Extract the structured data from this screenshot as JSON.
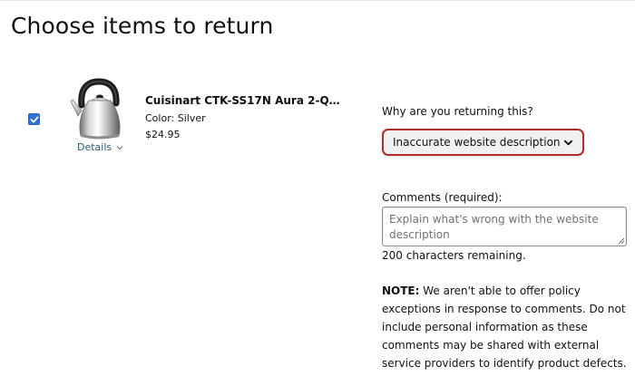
{
  "page": {
    "title": "Choose items to return"
  },
  "item": {
    "selected": true,
    "image_icon": "kettle-image",
    "details_label": "Details",
    "title": "Cuisinart CTK-SS17N Aura 2-Quart...",
    "color": "Color: Silver",
    "price": "$24.95"
  },
  "reason": {
    "label": "Why are you returning this?",
    "selected": "Inaccurate website description",
    "error_color": "#b12c2c"
  },
  "comments": {
    "label": "Comments (required):",
    "value": "",
    "placeholder": "Explain what's wrong with the website description",
    "remaining": "200 characters remaining."
  },
  "note": {
    "prefix": "NOTE:",
    "text": "We aren't able to offer policy exceptions in response to comments. Do not include personal information as these comments may be shared with external service providers to identify product defects."
  },
  "colors": {
    "link": "#2a5d75",
    "checkbox": "#2f6fd6",
    "text": "#0f1111"
  }
}
